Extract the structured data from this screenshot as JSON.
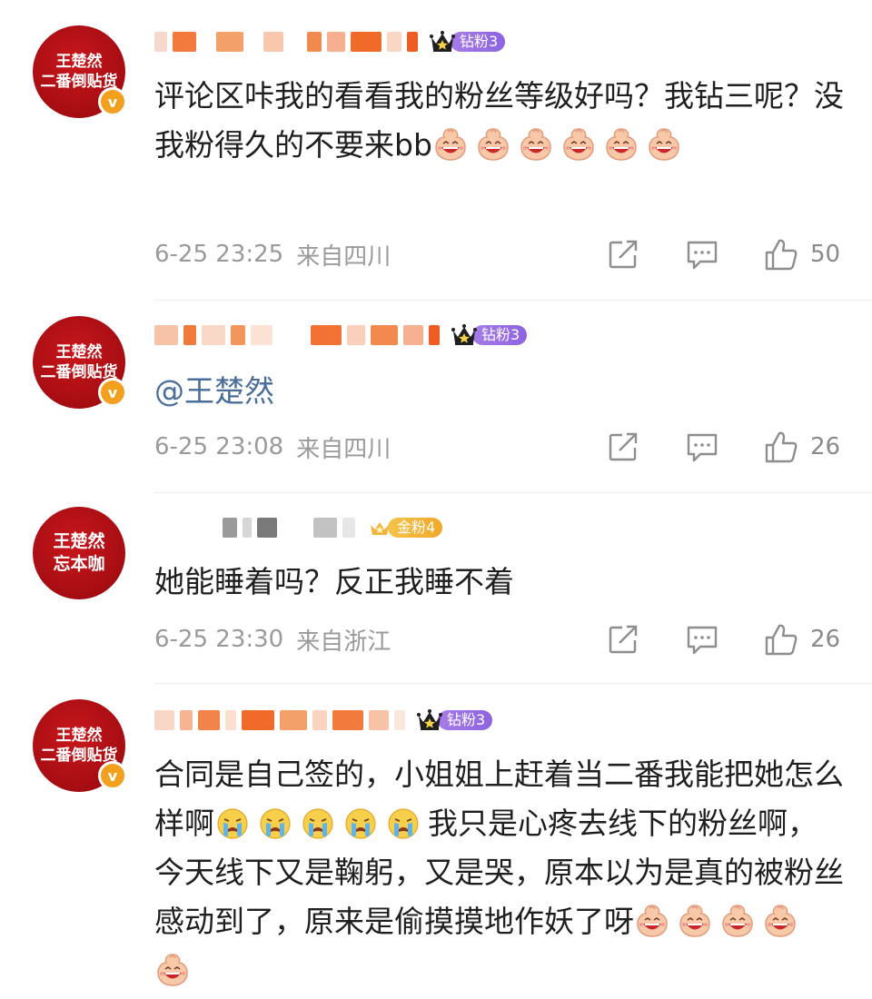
{
  "colors": {
    "avatar_red": "#b01016",
    "diamond_badge": "#9a6ee6",
    "gold_badge": "#f2b33a",
    "mention_blue": "#4a6e9c",
    "meta_gray": "#9a9a9a"
  },
  "comments": [
    {
      "avatar": {
        "lines": [
          "王楚然",
          "二番倒贴货"
        ],
        "verified": "v"
      },
      "fan_badge": {
        "label": "钻粉3",
        "type": "diamond"
      },
      "text_main": "评论区咔我的看看我的粉丝等级好吗？我钻三呢？没我粉得久的不要来bb",
      "emojis_after": [
        "laugh-emoji",
        "laugh-emoji",
        "laugh-emoji",
        "laugh-emoji",
        "laugh-emoji",
        "laugh-emoji"
      ],
      "time": "6-25 23:25",
      "location": "来自四川",
      "likes": "50"
    },
    {
      "avatar": {
        "lines": [
          "王楚然",
          "二番倒贴货"
        ],
        "verified": "v"
      },
      "fan_badge": {
        "label": "钻粉3",
        "type": "diamond"
      },
      "mention": "@王楚然",
      "time": "6-25 23:08",
      "location": "来自四川",
      "likes": "26"
    },
    {
      "avatar": {
        "lines": [
          "王楚然",
          "忘本咖"
        ]
      },
      "fan_badge": {
        "label": "金粉4",
        "type": "gold"
      },
      "text_main": "她能睡着吗？反正我睡不着",
      "time": "6-25 23:30",
      "location": "来自浙江",
      "likes": "26"
    },
    {
      "avatar": {
        "lines": [
          "王楚然",
          "二番倒贴货"
        ],
        "verified": "v"
      },
      "fan_badge": {
        "label": "钻粉3",
        "type": "diamond"
      },
      "text_part1": "合同是自己签的，小姐姐上赶着当二番我能把她怎么样啊",
      "cry_emojis": [
        "cry-emoji",
        "cry-emoji",
        "cry-emoji",
        "cry-emoji",
        "cry-emoji"
      ],
      "text_part2": "我只是心疼去线下的粉丝啊，今天线下又是鞠躬，又是哭，原本以为是真的被粉丝感动到了，原来是偷摸摸地作妖了呀",
      "emojis_after": [
        "laugh-emoji",
        "laugh-emoji",
        "laugh-emoji",
        "laugh-emoji",
        "laugh-emoji"
      ]
    }
  ],
  "icons": {
    "share": "share-icon",
    "comment": "comment-icon",
    "like": "like-icon",
    "crown": "crown-icon"
  }
}
